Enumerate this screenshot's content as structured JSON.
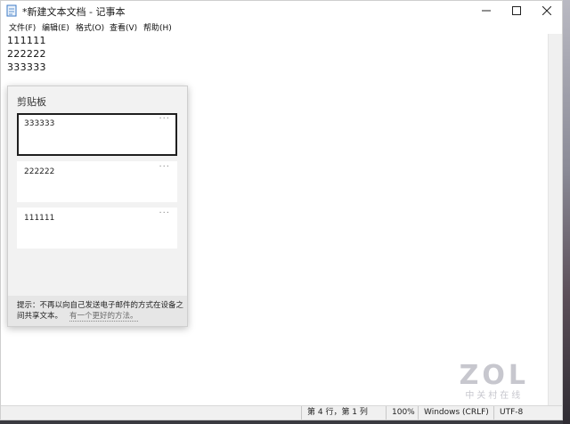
{
  "window": {
    "title": "*新建文本文档 - 记事本"
  },
  "menu": [
    "文件(F)",
    "编辑(E)",
    "格式(O)",
    "查看(V)",
    "帮助(H)"
  ],
  "editor": {
    "lines": [
      "111111",
      "222222",
      "333333"
    ]
  },
  "clipboard": {
    "title": "剪贴板",
    "items": [
      {
        "text": "333333",
        "more": "···"
      },
      {
        "text": "222222",
        "more": "···"
      },
      {
        "text": "111111",
        "more": "···"
      }
    ],
    "tip": "提示：不再以向自己发送电子邮件的方式在设备之间共享文本。",
    "link": "有一个更好的方法。"
  },
  "status": {
    "position": "第 4 行，第 1 列",
    "zoom": "100%",
    "line_ending": "Windows (CRLF)",
    "encoding": "UTF-8"
  },
  "watermark": {
    "logo": "ZOL",
    "sub": "中关村在线"
  },
  "colors": {
    "selection_border": "#1f1f1f",
    "panel_bg": "#f2f2f2"
  }
}
